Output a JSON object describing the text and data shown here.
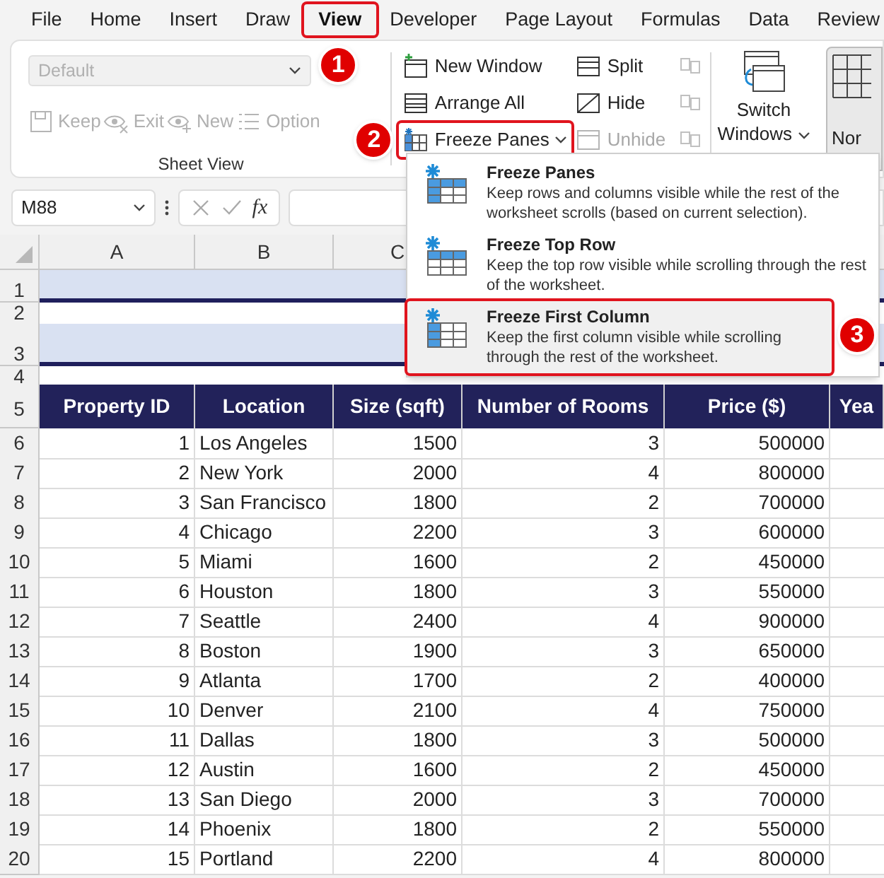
{
  "menu_tabs": [
    {
      "label": "File",
      "selected": false
    },
    {
      "label": "Home",
      "selected": false
    },
    {
      "label": "Insert",
      "selected": false
    },
    {
      "label": "Draw",
      "selected": false
    },
    {
      "label": "View",
      "selected": true,
      "callout": "1"
    },
    {
      "label": "Developer",
      "selected": false
    },
    {
      "label": "Page Layout",
      "selected": false
    },
    {
      "label": "Formulas",
      "selected": false
    },
    {
      "label": "Data",
      "selected": false
    },
    {
      "label": "Review",
      "selected": false
    }
  ],
  "sheet_view": {
    "dropdown": {
      "placeholder": "Default",
      "disabled": true
    },
    "buttons": [
      {
        "label": "Keep",
        "disabled": true
      },
      {
        "label": "Exit",
        "disabled": true
      },
      {
        "label": "New",
        "disabled": true
      },
      {
        "label": "Option",
        "disabled": true
      }
    ],
    "group_label": "Sheet View"
  },
  "window_group": {
    "buttons": [
      {
        "label": "New Window",
        "disabled": false
      },
      {
        "label": "Split",
        "disabled": false
      },
      {
        "label": "Arrange All",
        "disabled": false
      },
      {
        "label": "Hide",
        "disabled": false
      },
      {
        "label": "Freeze Panes",
        "disabled": false,
        "dropdown": true,
        "callout": "2"
      },
      {
        "label": "Unhide",
        "disabled": true
      }
    ],
    "small_buttons": [
      {
        "disabled": true
      },
      {
        "disabled": true
      },
      {
        "disabled": true
      }
    ],
    "switch_windows": "Switch Windows",
    "next_button": "Nor"
  },
  "formula_bar": {
    "name_box": "M88",
    "function_label": "fx"
  },
  "freeze_menu": [
    {
      "title": "Freeze Panes",
      "description": "Keep rows and columns visible while the rest of the worksheet scrolls (based on current selection).",
      "selected": false
    },
    {
      "title": "Freeze Top Row",
      "description": "Keep the top row visible while scrolling through the rest of the worksheet.",
      "selected": false
    },
    {
      "title": "Freeze First Column",
      "description": "Keep the first column visible while scrolling through the rest of the worksheet.",
      "selected": true,
      "callout": "3"
    }
  ],
  "sheet": {
    "column_letters": [
      "A",
      "B",
      "C"
    ],
    "header_row_number": "5",
    "band_rows": [
      {
        "number": "1",
        "kind": "band"
      },
      {
        "number": "2",
        "kind": "blank"
      },
      {
        "number": "3",
        "kind": "band"
      },
      {
        "number": "4",
        "kind": "blank"
      }
    ],
    "columns": [
      "Property ID",
      "Location",
      "Size (sqft)",
      "Number of Rooms",
      "Price ($)",
      "Yea"
    ],
    "rows": [
      {
        "number": "6",
        "cells": [
          "1",
          "Los Angeles",
          "1500",
          "3",
          "500000"
        ]
      },
      {
        "number": "7",
        "cells": [
          "2",
          "New York",
          "2000",
          "4",
          "800000"
        ]
      },
      {
        "number": "8",
        "cells": [
          "3",
          "San Francisco",
          "1800",
          "2",
          "700000"
        ]
      },
      {
        "number": "9",
        "cells": [
          "4",
          "Chicago",
          "2200",
          "3",
          "600000"
        ]
      },
      {
        "number": "10",
        "cells": [
          "5",
          "Miami",
          "1600",
          "2",
          "450000"
        ]
      },
      {
        "number": "11",
        "cells": [
          "6",
          "Houston",
          "1800",
          "3",
          "550000"
        ]
      },
      {
        "number": "12",
        "cells": [
          "7",
          "Seattle",
          "2400",
          "4",
          "900000"
        ]
      },
      {
        "number": "13",
        "cells": [
          "8",
          "Boston",
          "1900",
          "3",
          "650000"
        ]
      },
      {
        "number": "14",
        "cells": [
          "9",
          "Atlanta",
          "1700",
          "2",
          "400000"
        ]
      },
      {
        "number": "15",
        "cells": [
          "10",
          "Denver",
          "2100",
          "4",
          "750000"
        ]
      },
      {
        "number": "16",
        "cells": [
          "11",
          "Dallas",
          "1800",
          "3",
          "500000"
        ]
      },
      {
        "number": "17",
        "cells": [
          "12",
          "Austin",
          "1600",
          "2",
          "450000"
        ]
      },
      {
        "number": "18",
        "cells": [
          "13",
          "San Diego",
          "2000",
          "3",
          "700000"
        ]
      },
      {
        "number": "19",
        "cells": [
          "14",
          "Phoenix",
          "1800",
          "2",
          "550000"
        ]
      },
      {
        "number": "20",
        "cells": [
          "15",
          "Portland",
          "2200",
          "4",
          "800000"
        ]
      }
    ]
  }
}
